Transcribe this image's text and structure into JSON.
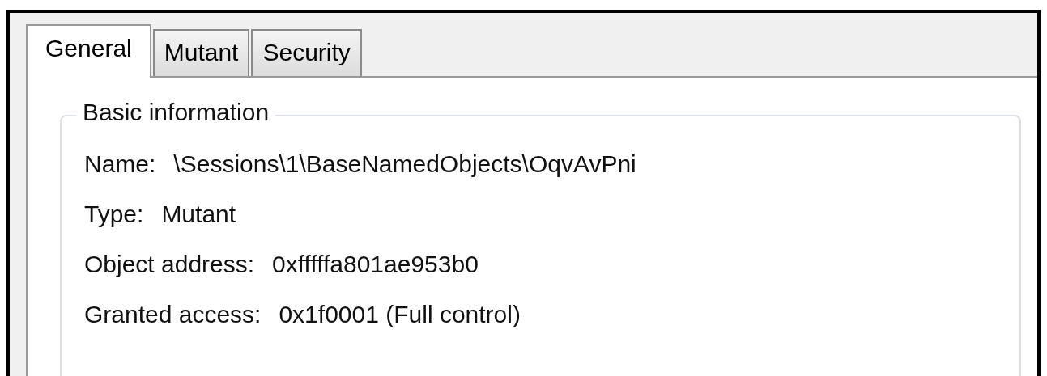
{
  "tabs": [
    {
      "label": "General",
      "selected": true
    },
    {
      "label": "Mutant",
      "selected": false
    },
    {
      "label": "Security",
      "selected": false
    }
  ],
  "group": {
    "title": "Basic information",
    "fields": [
      {
        "label": "Name:",
        "value": "\\Sessions\\1\\BaseNamedObjects\\OqvAvPni"
      },
      {
        "label": "Type:",
        "value": "Mutant"
      },
      {
        "label": "Object address:",
        "value": "0xfffffa801ae953b0"
      },
      {
        "label": "Granted access:",
        "value": "0x1f0001 (Full control)"
      }
    ]
  }
}
